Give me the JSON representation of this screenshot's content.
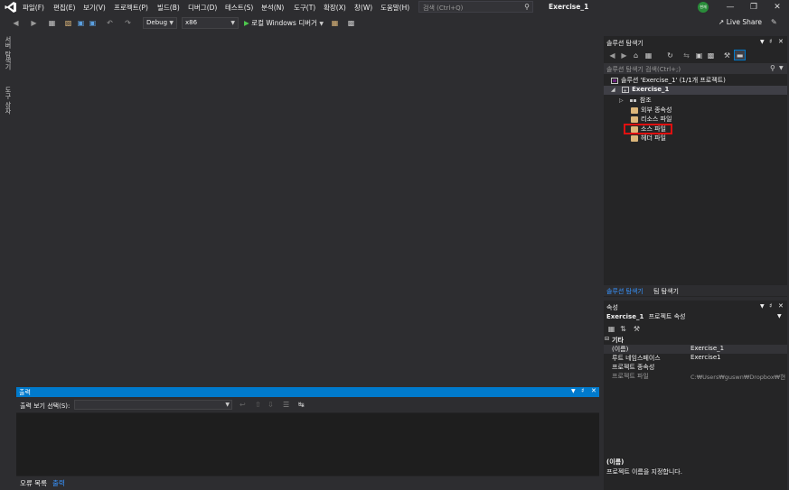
{
  "menu": {
    "items": [
      "파일(F)",
      "편집(E)",
      "보기(V)",
      "프로젝트(P)",
      "빌드(B)",
      "디버그(D)",
      "테스트(S)",
      "분석(N)",
      "도구(T)",
      "확장(X)",
      "창(W)",
      "도움말(H)"
    ]
  },
  "search": {
    "placeholder": "검색 (Ctrl+Q)"
  },
  "window": {
    "title": "Exercise_1",
    "user_initials": "현재"
  },
  "toolbar": {
    "config": "Debug",
    "platform": "x86",
    "run_label": "로컬 Windows 디버거",
    "live_share": "Live Share"
  },
  "left_strip": {
    "server_explorer": "서버 탐색기",
    "toolbox": "도구 상자"
  },
  "output": {
    "title": "출력",
    "source_label": "출력 보기 선택(S):",
    "source_value": ""
  },
  "bottom_tabs": [
    "오류 목록",
    "출력"
  ],
  "solution_explorer": {
    "title": "솔루션 탐색기",
    "search_placeholder": "솔루션 탐색기 검색(Ctrl+;)",
    "tree": [
      {
        "label": "솔루션 'Exercise_1' (1/1개 프로젝트)",
        "icon": "solution-icon"
      },
      {
        "label": "Exercise_1",
        "icon": "project-icon"
      },
      {
        "label": "참조",
        "icon": "references-icon"
      },
      {
        "label": "외부 종속성",
        "icon": "folder-icon"
      },
      {
        "label": "리소스 파일",
        "icon": "folder-icon"
      },
      {
        "label": "소스 파일",
        "icon": "folder-icon"
      },
      {
        "label": "헤더 파일",
        "icon": "folder-icon"
      }
    ],
    "tabs": [
      "솔루션 탐색기",
      "팀 탐색기"
    ]
  },
  "properties": {
    "title": "속성",
    "object": "Exercise_1",
    "object_type": "프로젝트 속성",
    "category": "기타",
    "rows": [
      {
        "name": "(이름)",
        "value": "Exercise_1"
      },
      {
        "name": "루트 네임스페이스",
        "value": "Exercise1"
      },
      {
        "name": "프로젝트 종속성",
        "value": ""
      },
      {
        "name": "프로젝트 파일",
        "value": "C:₩Users₩guswn₩Dropbox₩현준"
      }
    ],
    "desc_title": "(이름)",
    "desc_text": "프로젝트 이름을 지정합니다."
  }
}
